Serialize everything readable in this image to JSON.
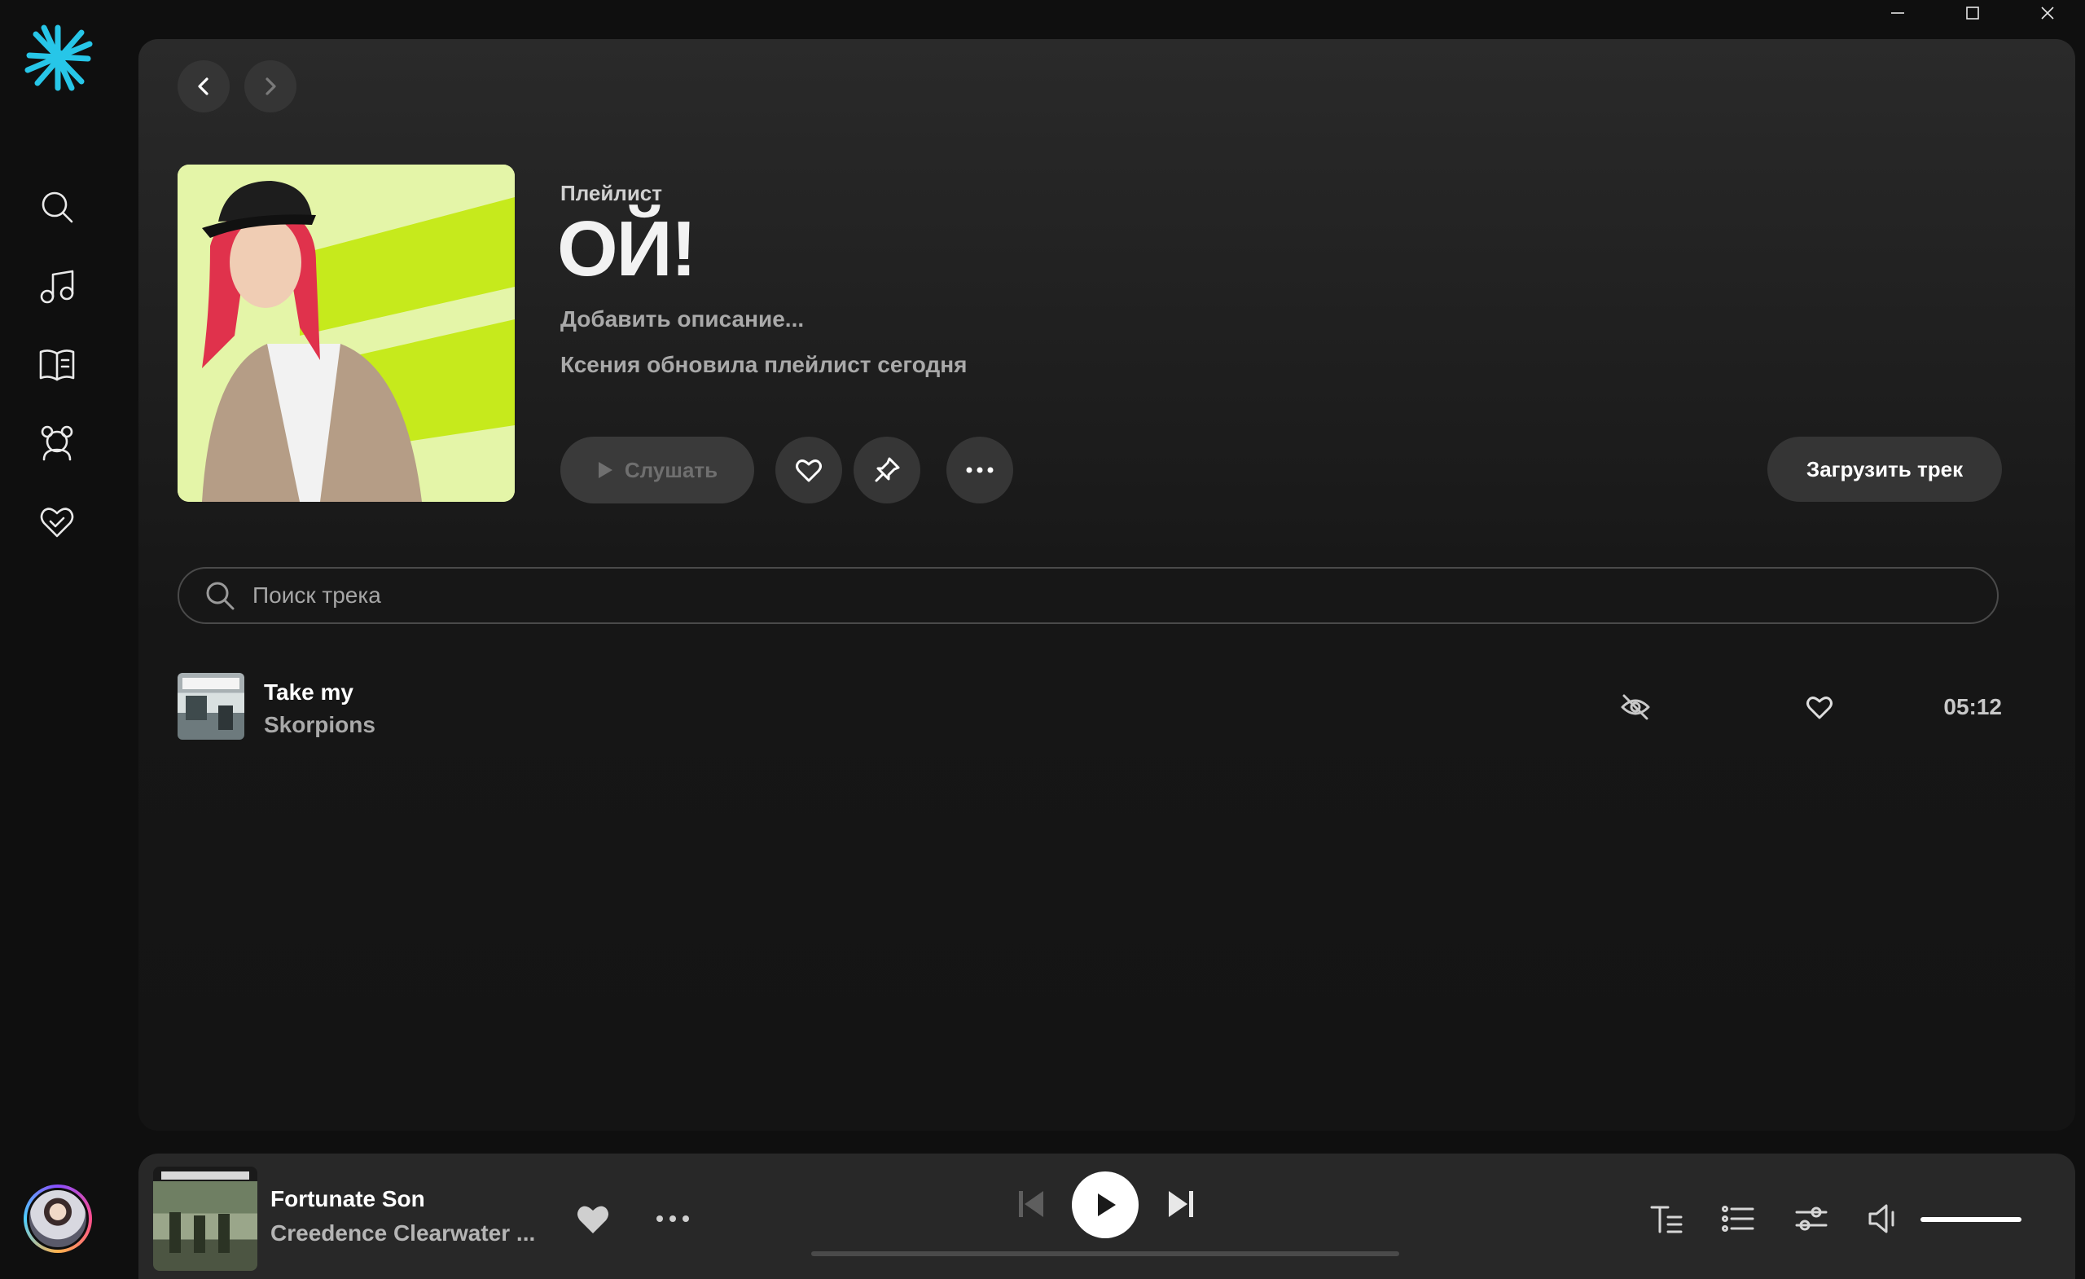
{
  "window": {
    "minimize_icon": "minimize-icon",
    "maximize_icon": "maximize-icon",
    "close_icon": "close-icon"
  },
  "sidebar": {
    "logo_icon": "starburst-logo-icon",
    "accent_color": "#27c6e8",
    "items": [
      {
        "name": "search",
        "icon": "search-icon"
      },
      {
        "name": "music",
        "icon": "music-note-icon"
      },
      {
        "name": "library",
        "icon": "book-list-icon"
      },
      {
        "name": "kids",
        "icon": "bear-icon"
      },
      {
        "name": "favorites",
        "icon": "heart-check-icon"
      }
    ],
    "avatar_icon": "user-avatar"
  },
  "playlist": {
    "type_label": "Плейлист",
    "title": "ОЙ!",
    "description_placeholder": "Добавить описание...",
    "updated_text": "Ксения обновила плейлист сегодня",
    "cover_accent": "#c6ea1c",
    "listen_label": "Слушать",
    "upload_label": "Загрузить трек"
  },
  "search": {
    "placeholder": "Поиск трека"
  },
  "tracks": [
    {
      "title": "Take my",
      "artist": "Skorpions",
      "duration": "05:12"
    }
  ],
  "player": {
    "title": "Fortunate Son",
    "artist": "Creedence Clearwater ...",
    "progress": 0,
    "volume": 1.0
  }
}
